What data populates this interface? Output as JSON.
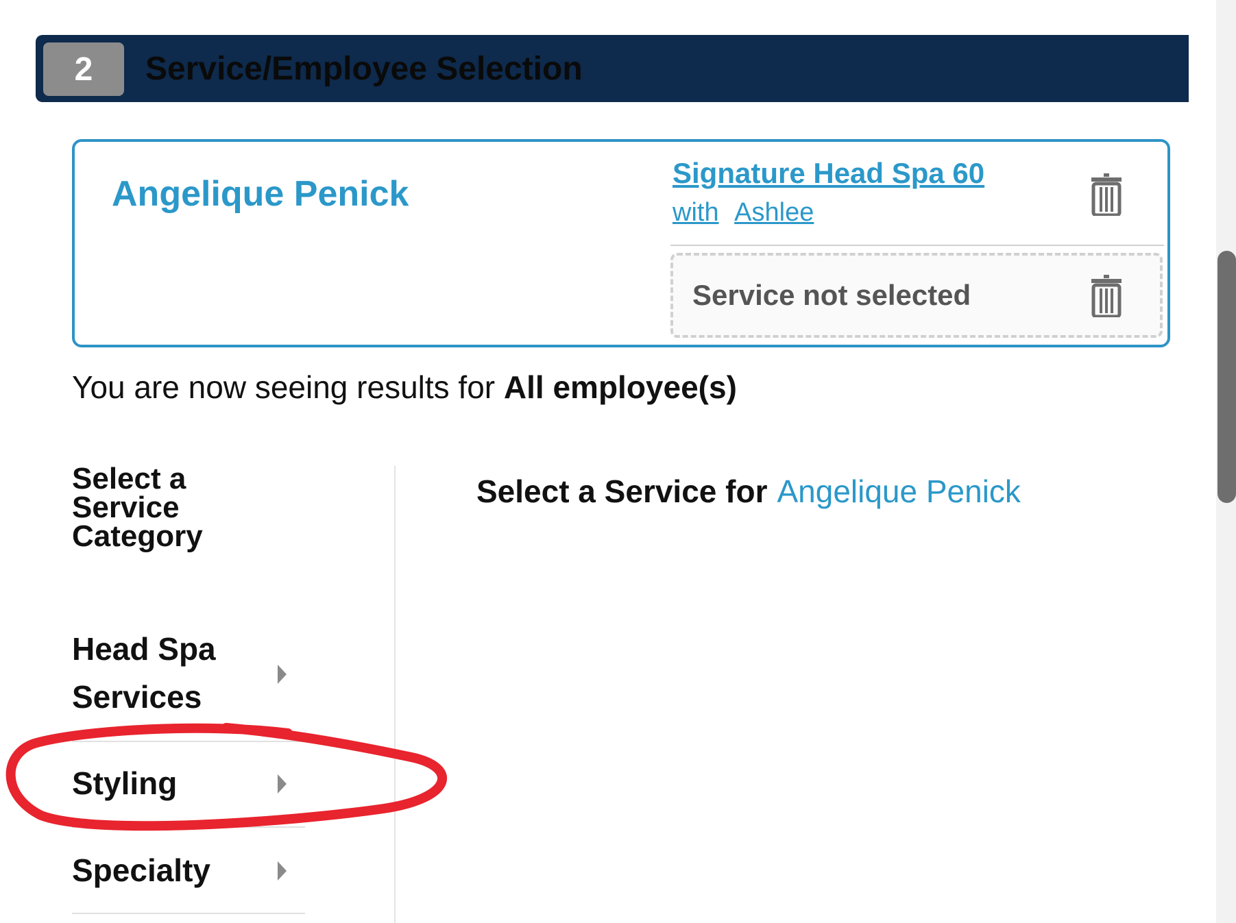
{
  "step": {
    "number": "2",
    "title": "Service/Employee Selection"
  },
  "guest": {
    "name": "Angelique Penick",
    "selected_service": {
      "name": "Signature Head Spa 60",
      "with_prefix": "with",
      "employee": "Ashlee"
    },
    "empty_slot_text": "Service not selected"
  },
  "results": {
    "prefix": "You are now seeing results for ",
    "value": "All employee(s)"
  },
  "categories": {
    "heading": "Select a Service Category",
    "items": [
      {
        "label": "Head Spa Services"
      },
      {
        "label": "Styling"
      },
      {
        "label": "Specialty"
      }
    ]
  },
  "service_panel": {
    "heading": "Select a Service for",
    "guest_name": "Angelique Penick"
  },
  "colors": {
    "header_bg": "#0e2a4c",
    "accent": "#2b98c9",
    "annotation": "#e8242e"
  },
  "icons": [
    "trash-icon",
    "chevron-right-icon"
  ]
}
